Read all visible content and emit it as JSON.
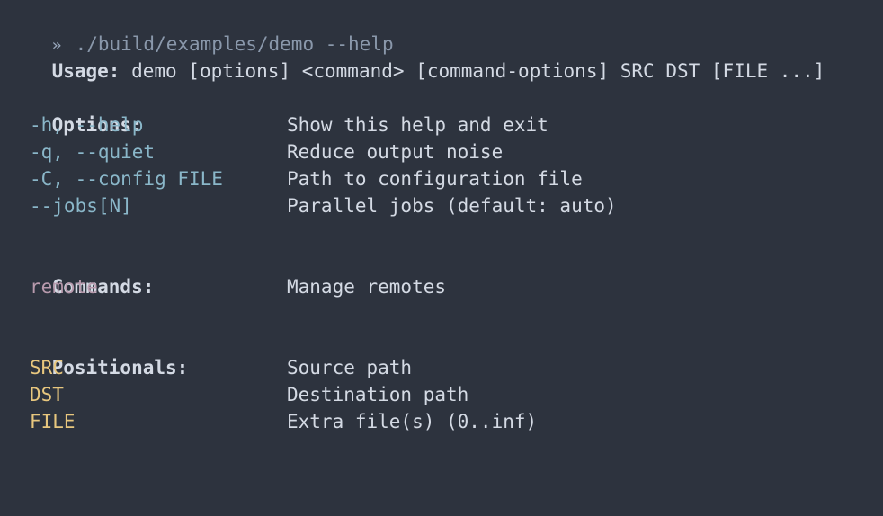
{
  "prompt": {
    "icon": "chevron-double-right-icon",
    "path": "./build/examples/demo",
    "flag": "--help"
  },
  "usage": {
    "label": "Usage:",
    "text": "demo [options] <command> [command-options] SRC DST [FILE ...]"
  },
  "options": {
    "heading": "Options:",
    "items": [
      {
        "flag": "-h, --help",
        "desc": "Show this help and exit"
      },
      {
        "flag": "-q, --quiet",
        "desc": "Reduce output noise"
      },
      {
        "flag": "-C, --config FILE",
        "desc": "Path to configuration file"
      },
      {
        "flag": "--jobs[N]",
        "desc": "Parallel jobs (default: auto)"
      }
    ]
  },
  "commands": {
    "heading": "Commands:",
    "items": [
      {
        "name": "remote",
        "desc": "Manage remotes"
      }
    ]
  },
  "positionals": {
    "heading": "Positionals:",
    "items": [
      {
        "name": "SRC",
        "desc": "Source path"
      },
      {
        "name": "DST",
        "desc": "Destination path"
      },
      {
        "name": "FILE",
        "desc": "Extra file(s) (0..inf)"
      }
    ]
  },
  "colors": {
    "background": "#2d333e",
    "text": "#d4dae4",
    "option": "#8ab7c9",
    "command": "#b89aad",
    "positional": "#e8c77e",
    "prompt": "#8a98ab"
  }
}
